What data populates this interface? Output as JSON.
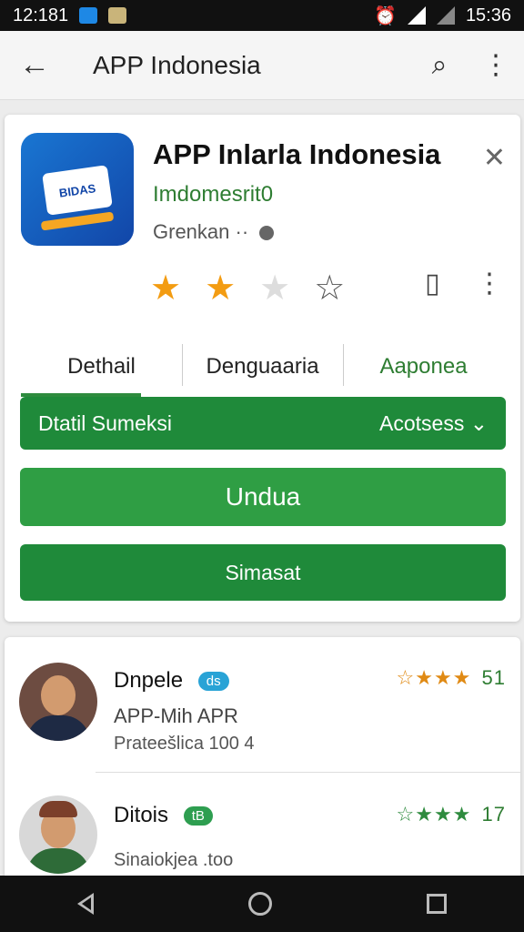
{
  "status_bar": {
    "time_left": "12:181",
    "time_right": "15:36"
  },
  "app_bar": {
    "title": "APP Indonesia",
    "back_icon": "←",
    "search_icon": "⌕",
    "more_icon": "⋮"
  },
  "app": {
    "name": "APP Inlarla Indonesia",
    "developer": "Imdomesrit0",
    "category": "Grenkan",
    "icon_badge": "BIDAS",
    "close_icon": "✕",
    "rating_filled": 2,
    "rating_total": 3
  },
  "tabs": [
    {
      "label": "Dethail",
      "active": true
    },
    {
      "label": "Denguaaria",
      "active": false
    },
    {
      "label": "Aaponea",
      "active": false
    }
  ],
  "select": {
    "left": "Dtatil Sumeksi",
    "right": "Acotsess",
    "chevron": "⌄"
  },
  "buttons": {
    "primary": "Undua",
    "secondary": "Simasat"
  },
  "reviews": [
    {
      "name": "Dnpele",
      "badge": "ds",
      "line1": "APP-Mih APR",
      "line2": "Prateešlica 100 4",
      "score": "51"
    },
    {
      "name": "Ditois",
      "badge": "tB",
      "line1": "Sinaiokjea .too",
      "score": "17"
    }
  ],
  "colors": {
    "accent_green": "#1f8a3a",
    "star_orange": "#f39c12",
    "brand_blue": "#1976d2"
  }
}
